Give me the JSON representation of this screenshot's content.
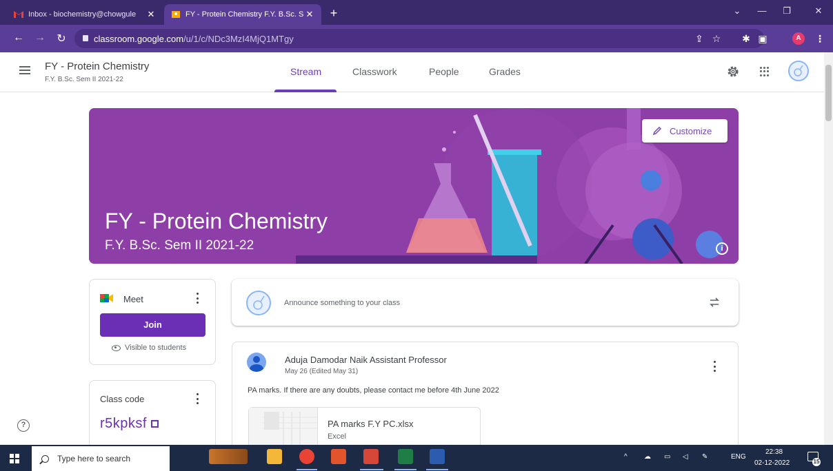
{
  "browser": {
    "tabs": [
      {
        "title": "Inbox - biochemistry@chowgule",
        "active": false
      },
      {
        "title": "FY - Protein Chemistry F.Y. B.Sc. S",
        "active": true
      }
    ],
    "url_domain": "classroom.google.com",
    "url_path": "/u/1/c/NDc3MzI4MjQ1MTgy",
    "profile_initial": "A",
    "theme_color": "#5a3d97"
  },
  "header": {
    "class_title": "FY - Protein Chemistry",
    "class_subtitle": "F.Y. B.Sc. Sem II 2021-22",
    "tabs": [
      {
        "label": "Stream",
        "active": true
      },
      {
        "label": "Classwork",
        "active": false
      },
      {
        "label": "People",
        "active": false
      },
      {
        "label": "Grades",
        "active": false
      }
    ]
  },
  "banner": {
    "title": "FY - Protein Chemistry",
    "subtitle": "F.Y. B.Sc. Sem II 2021-22",
    "customize_label": "Customize",
    "color": "#8e3ea7",
    "info_glyph": "i"
  },
  "meet": {
    "label": "Meet",
    "join_label": "Join",
    "visibility": "Visible to students"
  },
  "class_code": {
    "label": "Class code",
    "value": "r5kpksf"
  },
  "announce": {
    "placeholder": "Announce something to your class"
  },
  "post": {
    "author": "Aduja Damodar Naik Assistant Professor",
    "date": "May 26 (Edited May 31)",
    "text": "PA marks. If there are any doubts, please contact me before 4th June 2022",
    "attachment": {
      "name": "PA marks F.Y PC.xlsx",
      "type": "Excel"
    }
  },
  "help_glyph": "?",
  "taskbar": {
    "search_placeholder": "Type here to search",
    "language": "ENG",
    "time": "22:38",
    "date": "02-12-2022",
    "notifications": "15"
  }
}
